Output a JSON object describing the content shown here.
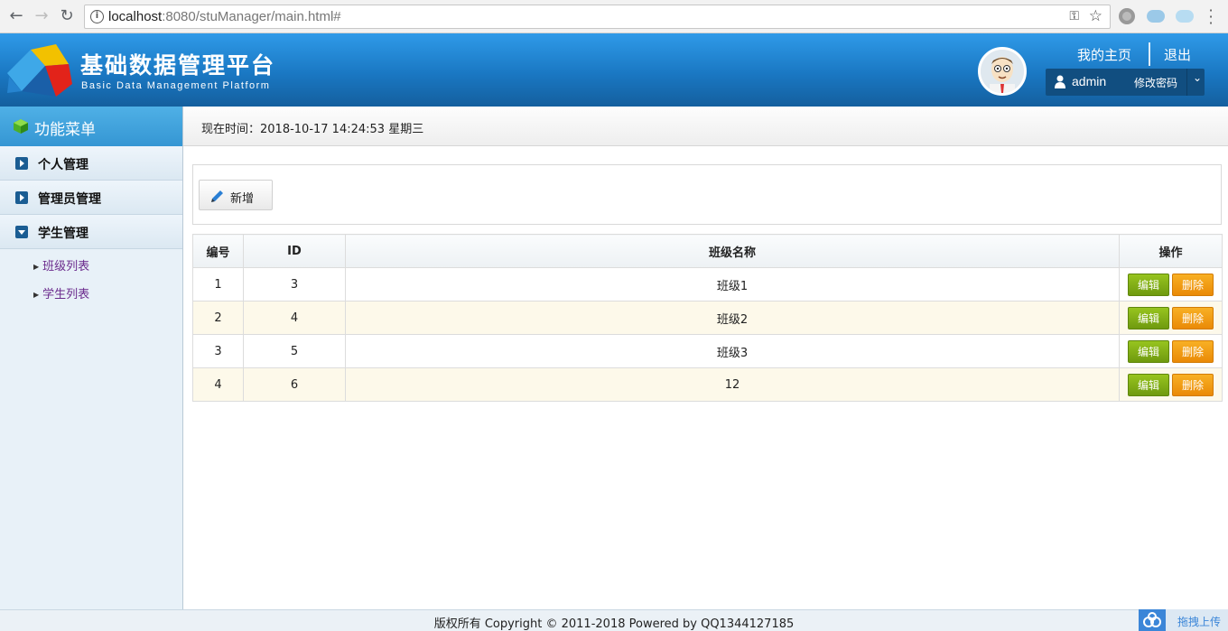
{
  "browser": {
    "url_host": "localhost",
    "url_rest": ":8080/stuManager/main.html#"
  },
  "header": {
    "title": "基础数据管理平台",
    "subtitle": "Basic Data Management Platform",
    "link_home": "我的主页",
    "link_logout": "退出",
    "username": "admin",
    "change_password": "修改密码"
  },
  "sidebar": {
    "heading": "功能菜单",
    "items": [
      {
        "label": "个人管理",
        "open": false
      },
      {
        "label": "管理员管理",
        "open": false
      },
      {
        "label": "学生管理",
        "open": true
      }
    ],
    "subitems": [
      "班级列表",
      "学生列表"
    ]
  },
  "timebar": {
    "text": "现在时间：2018-10-17 14:24:53 星期三"
  },
  "toolbar": {
    "add_label": "新增"
  },
  "table": {
    "headers": [
      "编号",
      "ID",
      "班级名称",
      "操作"
    ],
    "rows": [
      {
        "no": "1",
        "id": "3",
        "name": "班级1"
      },
      {
        "no": "2",
        "id": "4",
        "name": "班级2"
      },
      {
        "no": "3",
        "id": "5",
        "name": "班级3"
      },
      {
        "no": "4",
        "id": "6",
        "name": "12"
      }
    ],
    "edit_label": "编辑",
    "delete_label": "删除"
  },
  "footer": {
    "text": "版权所有 Copyright © 2011-2018 Powered by QQ1344127185",
    "upload_label": "拖拽上传"
  },
  "colors": {
    "header_blue": "#1a78c3",
    "edit_green": "#7fae16",
    "delete_orange": "#f09a10"
  }
}
